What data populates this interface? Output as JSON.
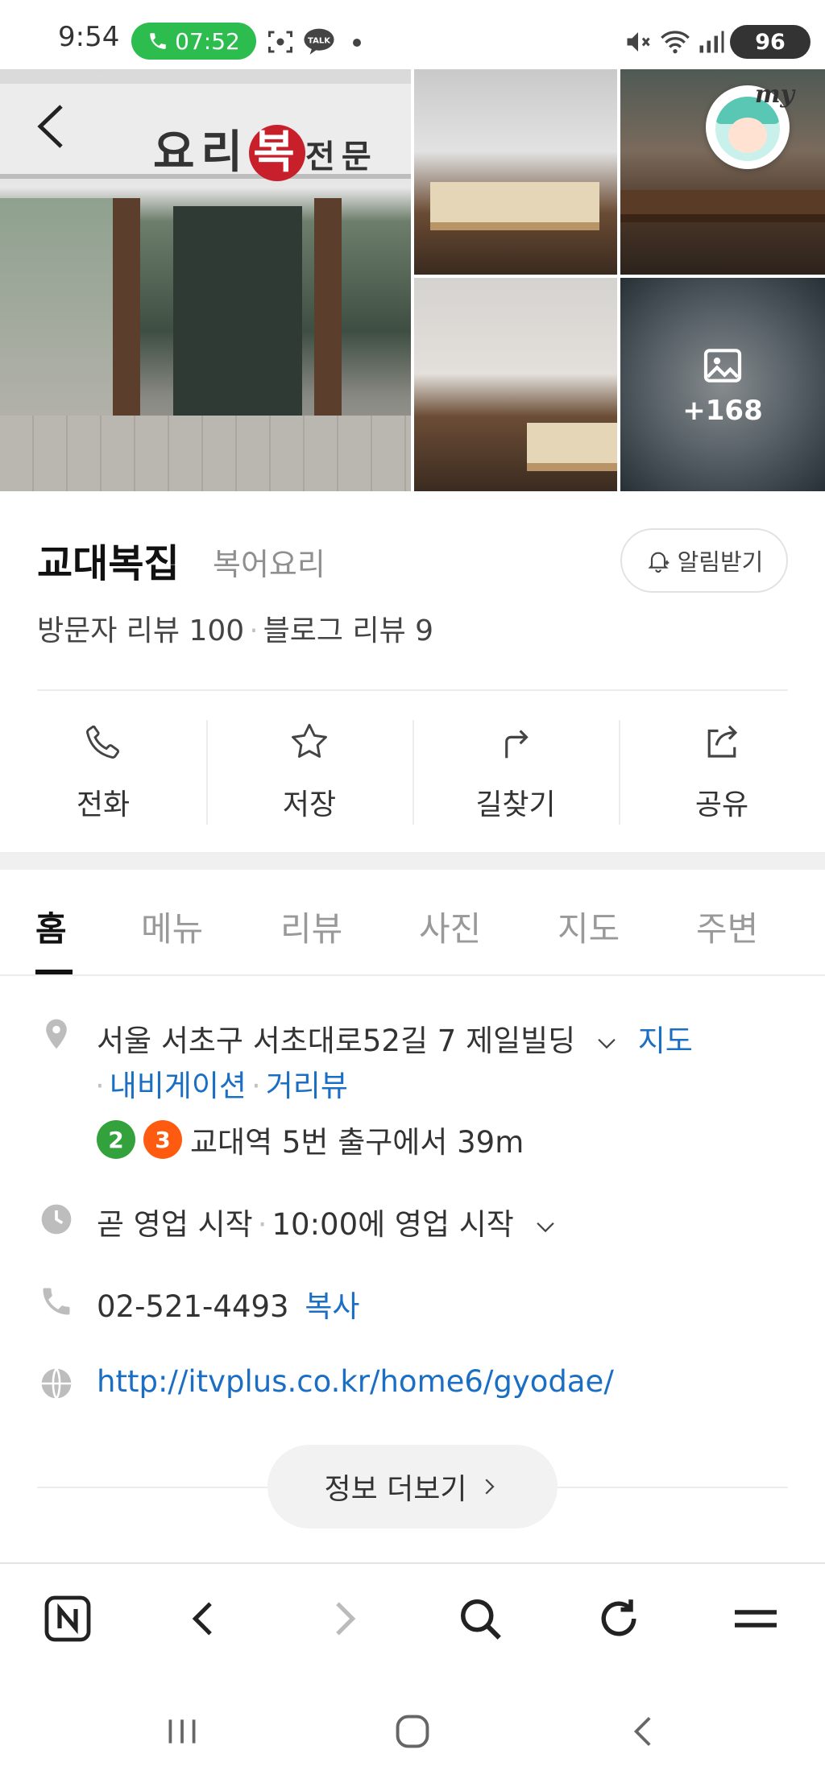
{
  "status_bar": {
    "time": "9:54",
    "call_timer": "07:52",
    "battery": "96",
    "icons": [
      "screenshot-icon",
      "talk-icon",
      "dot-icon",
      "mute-icon",
      "wifi-icon",
      "signal-icon"
    ]
  },
  "photos": {
    "more_count": "+168",
    "sign_text_1": "요리",
    "sign_text_2": "복",
    "sign_text_3": "전문",
    "profile_label": "my"
  },
  "place": {
    "name": "교대복집",
    "category": "복어요리",
    "alarm_label": "알림받기",
    "visitor_reviews": "방문자 리뷰 100",
    "blog_reviews": "블로그 리뷰 9",
    "separator": "·"
  },
  "actions": [
    {
      "label": "전화",
      "icon": "phone-icon"
    },
    {
      "label": "저장",
      "icon": "star-icon"
    },
    {
      "label": "길찾기",
      "icon": "directions-icon"
    },
    {
      "label": "공유",
      "icon": "share-icon"
    }
  ],
  "tabs": [
    {
      "label": "홈",
      "active": true
    },
    {
      "label": "메뉴",
      "active": false
    },
    {
      "label": "리뷰",
      "active": false
    },
    {
      "label": "사진",
      "active": false
    },
    {
      "label": "지도",
      "active": false
    },
    {
      "label": "주변",
      "active": false
    }
  ],
  "info": {
    "address": "서울 서초구 서초대로52길 7 제일빌딩",
    "map_link": "지도",
    "navigation_link": "내비게이션",
    "street_view_link": "거리뷰",
    "subway_lines": [
      "2",
      "3"
    ],
    "subway_text": "교대역 5번 출구에서 39m",
    "hours_status": "곧 영업 시작",
    "hours_detail": "10:00에 영업 시작",
    "phone": "02-521-4493",
    "copy_label": "복사",
    "website": "http://itvplus.co.kr/home6/gyodae/",
    "more_info": "정보 더보기"
  },
  "colors": {
    "link": "#1a6fc4",
    "call_pill": "#2dbc4e",
    "subway_line_2": "#33a23d",
    "subway_line_3": "#fe5b10"
  }
}
